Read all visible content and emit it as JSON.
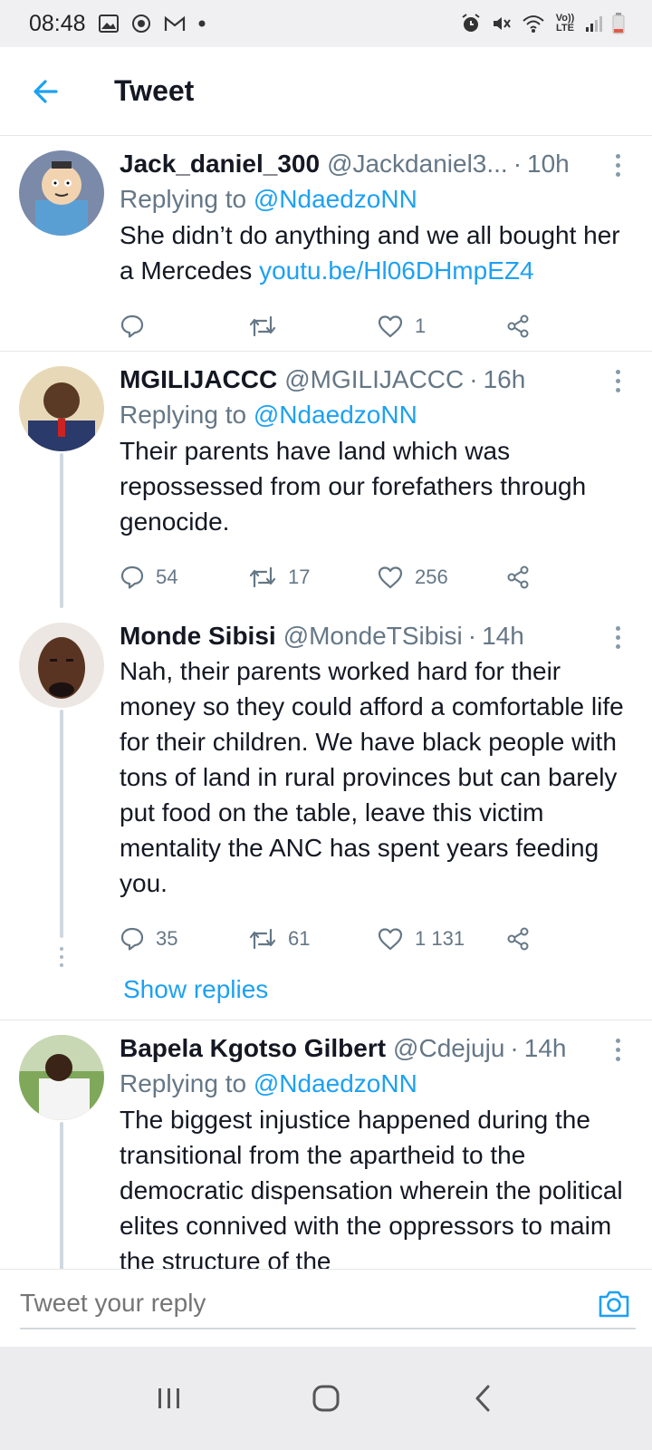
{
  "status": {
    "time": "08:48",
    "lte_label": "Vo)) LTE"
  },
  "header": {
    "title": "Tweet"
  },
  "tweets": [
    {
      "name": "Jack_daniel_300",
      "handle": "@Jackdaniel3...",
      "time": "10h",
      "replying_label": "Replying to",
      "replying_to": "@NdaedzoNN",
      "text": "She didn’t do anything and we all bought her a Mercedes ",
      "link": "youtu.be/Hl06DHmpEZ4",
      "replies": "",
      "retweets": "",
      "likes": "1"
    },
    {
      "name": "MGILIJACCC",
      "handle": "@MGILIJACCC",
      "time": "16h",
      "replying_label": "Replying to",
      "replying_to": "@NdaedzoNN",
      "text": "Their parents have land which was repossessed from our forefathers through genocide.",
      "replies": "54",
      "retweets": "17",
      "likes": "256"
    },
    {
      "name": "Monde Sibisi",
      "handle": "@MondeTSibisi",
      "time": "14h",
      "text": "Nah, their parents worked hard for their money so they could afford a comfortable life for their children. We have black people with tons of land in rural provinces but can barely put food on the table, leave this victim mentality the ANC has spent years feeding you.",
      "replies": "35",
      "retweets": "61",
      "likes": "1 131",
      "show_replies": "Show replies"
    },
    {
      "name": "Bapela Kgotso Gilbert",
      "handle": "@Cdejuju",
      "time": "14h",
      "replying_label": "Replying to",
      "replying_to": "@NdaedzoNN",
      "text": "The biggest injustice happened during the transitional from the apartheid to the democratic dispensation wherein the political elites connived with the oppressors to maim the structure of the"
    }
  ],
  "reply_bar": {
    "placeholder": "Tweet your reply"
  },
  "colors": {
    "accent": "#1da1f2",
    "secondary_text": "#657786"
  }
}
